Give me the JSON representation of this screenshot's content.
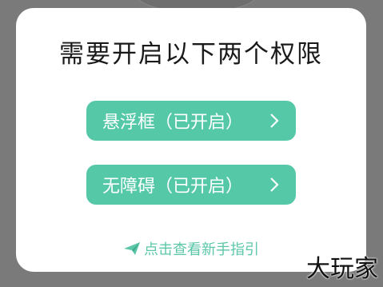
{
  "dialog": {
    "title": "需要开启以下两个权限",
    "permissions": [
      {
        "label": "悬浮框（已开启）"
      },
      {
        "label": "无障碍（已开启）"
      }
    ],
    "guide_link": "点击查看新手指引"
  },
  "watermark": "大玩家",
  "colors": {
    "accent": "#55c8a7",
    "guide_text": "#5cc7a8",
    "overlay": "#7a7a7a"
  },
  "icons": [
    "chevron-right-icon",
    "paper-plane-icon"
  ]
}
